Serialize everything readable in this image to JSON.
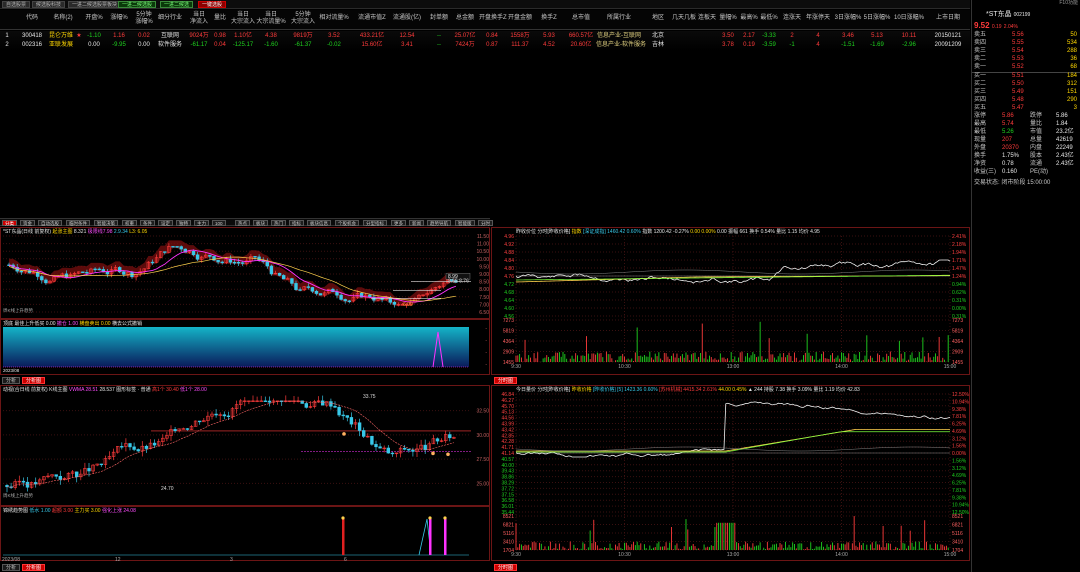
{
  "top_tabs": [
    {
      "label": "自选股票",
      "style": "normal"
    },
    {
      "label": "候选股科技",
      "style": "normal"
    },
    {
      "label": "一进二候选股票板块",
      "style": "normal"
    },
    {
      "label": "一进二候选股",
      "style": "green"
    },
    {
      "label": "一进二候选",
      "style": "green"
    },
    {
      "label": "一键选股",
      "style": "red"
    }
  ],
  "window_title": "F10功能",
  "columns": [
    "代码",
    "名称(2)",
    "开盘%",
    "涨幅%",
    "5分钟\n涨幅%",
    "细分行业",
    "当日\n净流入",
    "量比",
    "当日\n大宗流入",
    "当日\n大宗流量%",
    "5分钟\n大宗流入",
    "相对流量%",
    "流通市值Z",
    "流通股(亿)",
    "封单额",
    "总金额",
    "开盘换手Z",
    "开盘金额",
    "换手Z",
    "总市值",
    "所属行业",
    "地区",
    "几天几板",
    "连板天",
    "量幅%",
    "最高%",
    "最低%",
    "连涨天",
    "年涨停天",
    "3日涨幅%",
    "5日涨幅%",
    "10日涨幅%",
    "上市日期"
  ],
  "rows": [
    {
      "idx": "1",
      "code": "300418",
      "name": "昆仑万维",
      "star": "★",
      "c": [
        "-1.10",
        "1.16",
        "0.02",
        "互联网",
        "9024万",
        "0.98",
        "1.10亿",
        "4.38",
        "9819万",
        "3.52",
        "433.21亿",
        "12.54",
        "--",
        "25.07亿",
        "0.84",
        "1558万",
        "5.93",
        "660.57亿",
        "信息产业-互联网",
        "北京",
        "",
        "",
        "3.50",
        "2.17",
        "-3.33",
        "2",
        "4",
        "3.46",
        "5.13",
        "10.11",
        "20150121"
      ]
    },
    {
      "idx": "2",
      "code": "002316",
      "name": "亚联发展",
      "star": "",
      "c": [
        "0.00",
        "-9.95",
        "0.00",
        "软件服务",
        "-61.17",
        "0.04",
        "-125.17",
        "-1.60",
        "-61.37",
        "-0.02",
        "15.60亿",
        "3.41",
        "--",
        "7424万",
        "0.87",
        "111.37",
        "4.52",
        "20.60亿",
        "信息产业-软件服务",
        "吉林",
        "",
        "",
        "3.78",
        "0.19",
        "-3.59",
        "-1",
        "4",
        "-1.51",
        "-1.69",
        "-2.96",
        "20091209"
      ]
    }
  ],
  "sub_tabs": [
    "分类",
    "资金",
    "自动选股",
    "临时条件",
    "智能决策",
    "权重",
    "条件",
    "设定",
    "独特",
    "主力",
    "100",
    "热点",
    "板块",
    "热门",
    "指标",
    "板块信息",
    "个股机会",
    "分型指标",
    "更多",
    "新闻",
    "趋势导航",
    "智能版",
    "分时"
  ],
  "kchart_top": {
    "title": "*ST东晶(日线 前复权)",
    "title2": "起涨主图",
    "val1": "8.321",
    "val2": "极限线7.98",
    "val3": "2.9.34",
    "low_label": "L3: 6.05",
    "ylabels": [
      "11.50",
      "11.00",
      "10.50",
      "10.00",
      "9.50",
      "9.00",
      "8.50",
      "8.00",
      "7.50",
      "7.00",
      "6.50"
    ],
    "badge1": "8.99",
    "badge2": "8.96",
    "badge3": "8.55",
    "badge4": "8.76",
    "low_tag": "6.86",
    "mark_low": "6.09",
    "left_tag": "周K线上升趋势"
  },
  "ind_top": {
    "title": "顶底",
    "p1": "最佳上升低买 0.00",
    "p2": "撤仓 1.00",
    "p3": "横盘卖出 0.00",
    "p4": "横去公式撤销",
    "ylabels": [
      "-",
      "-",
      "-",
      "-"
    ],
    "xlabel_left": "2023/08",
    "tabs": [
      "分析",
      "分析图"
    ]
  },
  "kchart_bot": {
    "title": "动视(合日线 前复权)",
    "title2": "K线主图",
    "val1": "VWMA 28.51",
    "val2": "28.537",
    "val3": "图形标签 · 普通",
    "val4": "高1个 30.40",
    "val5": "低1个 28.00",
    "peak": "33.75",
    "low": "24.70",
    "ylabels": [
      "32.50",
      "30.00",
      "27.50",
      "25.00"
    ],
    "left_tag": "周K线上升趋势"
  },
  "ind_bot": {
    "title": "锦绣趋势图",
    "p1": "低水 1.00",
    "p2": "超额 3.00",
    "p3": "主力买 3.00",
    "p4": "强化上涨 24.08",
    "xlabels": [
      "2023/08",
      "12",
      "3",
      "6"
    ],
    "tabs": [
      "分析",
      "分析图"
    ]
  },
  "tchart_top": {
    "header": "昨收价位",
    "h1": "分时[昨收价格]",
    "h2": "指数",
    "h3": "[深证成指]",
    "h4": "1460.42 0.60%",
    "h5": "指数 1200.42 -0.27%",
    "h6": "0.00 0.00%",
    "h7": "0.00 振幅 661 换手 0.54% 量比 1.15 均价 4.95",
    "left": [
      "4.96",
      "4.92",
      "4.88",
      "4.84",
      "4.80",
      "4.76",
      "4.72",
      "4.68",
      "4.64",
      "4.60",
      "4.56"
    ],
    "right": [
      "2.41%",
      "2.18%",
      "1.94%",
      "1.71%",
      "1.47%",
      "1.24%",
      "0.94%",
      "0.62%",
      "0.31%",
      "0.00%",
      "0.31%"
    ],
    "vleft": [
      "7273",
      "5819",
      "4364",
      "2909",
      "1455"
    ],
    "vright": [
      "7273",
      "5819",
      "4364",
      "2909",
      "1455"
    ],
    "times": [
      "9:30",
      "10:30",
      "13:00",
      "14:00",
      "15:00"
    ],
    "tabs": [
      "分时图"
    ]
  },
  "tchart_bot": {
    "header": "今日量价",
    "h1": "分时[昨收价格]",
    "h2": "昨收价格",
    "h3": "[昨收价格]",
    "h4": "[5] 1423.36 0.60%",
    "h5": "[苏州机械] 4415.34 2.61%",
    "h6": "44.00 0.45%",
    "h7": "▲ 244 持股 7.38 换手 3.09% 量比 1.19 均价 42.83",
    "left": [
      "46.84",
      "46.27",
      "45.70",
      "45.13",
      "44.56",
      "43.99",
      "43.42",
      "42.85",
      "42.28",
      "41.71",
      "41.14",
      "40.57",
      "40.00",
      "39.43",
      "38.86",
      "38.29",
      "37.72",
      "37.15",
      "36.58",
      "36.01",
      "35.44"
    ],
    "right": [
      "12.50%",
      "10.94%",
      "9.38%",
      "7.81%",
      "6.25%",
      "4.69%",
      "3.12%",
      "1.56%",
      "0.00%",
      "1.56%",
      "3.12%",
      "4.69%",
      "6.25%",
      "7.81%",
      "9.38%",
      "10.94%",
      "12.50%"
    ],
    "vleft": [
      "8521",
      "6821",
      "5116",
      "3410",
      "1704"
    ],
    "vright": [
      "8521",
      "6821",
      "5116",
      "3410",
      "1704"
    ],
    "times": [
      "9:30",
      "10:30",
      "13:00",
      "14:00",
      "15:00"
    ],
    "tabs": [
      "分时图"
    ]
  },
  "right_panel": {
    "title": "*ST东晶",
    "code": "002199",
    "price": "9.52",
    "change": "0.19",
    "pct": "2.04%",
    "sells": [
      {
        "l": "卖五",
        "p": "5.56",
        "v": "50"
      },
      {
        "l": "卖四",
        "p": "5.55",
        "v": "534"
      },
      {
        "l": "卖三",
        "p": "5.54",
        "v": "288"
      },
      {
        "l": "卖二",
        "p": "5.53",
        "v": "36"
      },
      {
        "l": "卖一",
        "p": "5.52",
        "v": "68"
      }
    ],
    "buys": [
      {
        "l": "买一",
        "p": "5.51",
        "v": "184"
      },
      {
        "l": "买二",
        "p": "5.50",
        "v": "312"
      },
      {
        "l": "买三",
        "p": "5.49",
        "v": "151"
      },
      {
        "l": "买四",
        "p": "5.48",
        "v": "290"
      },
      {
        "l": "买五",
        "p": "5.47",
        "v": "3"
      }
    ],
    "stats": [
      {
        "l1": "涨停",
        "v1": "5.86",
        "l2": "跌停",
        "v2": "5.86"
      },
      {
        "l1": "最高",
        "v1": "5.74",
        "l2": "量比",
        "v2": "1.84"
      },
      {
        "l1": "最低",
        "v1": "5.26",
        "l2": "市值",
        "v2": "23.2亿"
      },
      {
        "l1": "现量",
        "v1": "207",
        "l2": "总量",
        "v2": "42619"
      },
      {
        "l1": "外盘",
        "v1": "20370",
        "l2": "内盘",
        "v2": "22249"
      },
      {
        "l1": "换手",
        "v1": "1.75%",
        "l2": "股本",
        "v2": "2.43亿"
      },
      {
        "l1": "净资",
        "v1": "0.78",
        "l2": "流通",
        "v2": "2.43亿"
      },
      {
        "l1": "收益(三)",
        "v1": "0.160",
        "l2": "PE(动)",
        "v2": ""
      }
    ],
    "status": "交易状态: 闭市阶段 15:00:00"
  },
  "colors": {
    "up": "#ff3b3b",
    "down": "#1fd41f",
    "cyan": "#38c8e8",
    "panel_border": "#6b1515"
  },
  "icons": [
    "close-icon",
    "star-icon"
  ]
}
